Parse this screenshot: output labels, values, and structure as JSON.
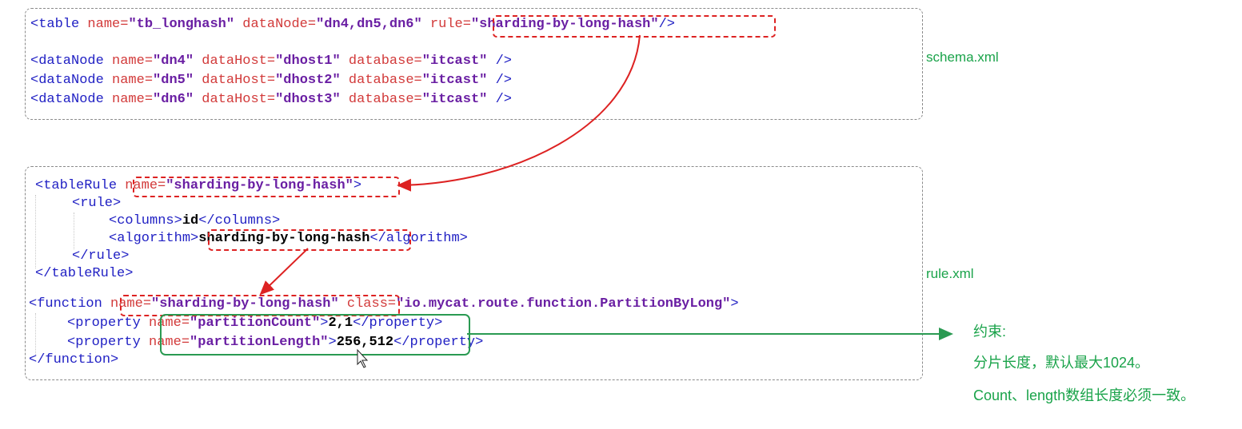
{
  "schema": {
    "table_line": {
      "open": "<table ",
      "name_attr": "name=",
      "name_val": "\"tb_longhash\"",
      "datanode_attr": " dataNode=",
      "datanode_val": "\"dn4,dn5,dn6\"",
      "rule_attr": "rule=",
      "rule_val": "\"sharding-by-long-hash\"",
      "close": "/>"
    },
    "datanodes": [
      {
        "open": "<dataNode ",
        "name_attr": "name=",
        "name_val": "\"dn4\"",
        "host_attr": " dataHost=",
        "host_val": "\"dhost1\"",
        "db_attr": " database=",
        "db_val": "\"itcast\"",
        "close": " />"
      },
      {
        "open": "<dataNode ",
        "name_attr": "name=",
        "name_val": "\"dn5\"",
        "host_attr": " dataHost=",
        "host_val": "\"dhost2\"",
        "db_attr": " database=",
        "db_val": "\"itcast\"",
        "close": " />"
      },
      {
        "open": "<dataNode ",
        "name_attr": "name=",
        "name_val": "\"dn6\"",
        "host_attr": " dataHost=",
        "host_val": "\"dhost3\"",
        "db_attr": " database=",
        "db_val": "\"itcast\"",
        "close": " />"
      }
    ],
    "file_label": "schema.xml"
  },
  "rule": {
    "tablerule_open": "<tableRule ",
    "tablerule_name_attr": "name=",
    "tablerule_name_val": "\"sharding-by-long-hash\"",
    "tablerule_gt": ">",
    "rule_open": "<rule>",
    "columns_open": "<columns>",
    "columns_val": "id",
    "columns_close": "</columns>",
    "algorithm_open": "<algorithm>",
    "algorithm_val": "sharding-by-long-hash",
    "algorithm_close": "</algorithm>",
    "rule_close": "</rule>",
    "tablerule_close": "</tableRule>",
    "function_open": "<function ",
    "function_name_attr": "name=",
    "function_name_val": "\"sharding-by-long-hash\"",
    "function_class_attr": " class=",
    "function_class_val": "\"io.mycat.route.function.PartitionByLong\"",
    "function_gt": ">",
    "properties": [
      {
        "open": "<property ",
        "name_attr": "name=",
        "name_val": "\"partitionCount\"",
        "gt": ">",
        "value": "2,1",
        "close": "</property>"
      },
      {
        "open": "<property ",
        "name_attr": "name=",
        "name_val": "\"partitionLength\"",
        "gt": ">",
        "value": "256,512",
        "close": "</property>"
      }
    ],
    "function_close": "</function>",
    "file_label": "rule.xml"
  },
  "notes": {
    "title": "约束:",
    "line1": "分片长度，默认最大1024。",
    "line2": "Count、length数组长度必须一致。"
  },
  "colors": {
    "tag": "#2121c4",
    "attr": "#d23a3a",
    "string": "#6a1fa3",
    "highlight_red": "#dd2222",
    "highlight_green": "#2a9a52"
  }
}
